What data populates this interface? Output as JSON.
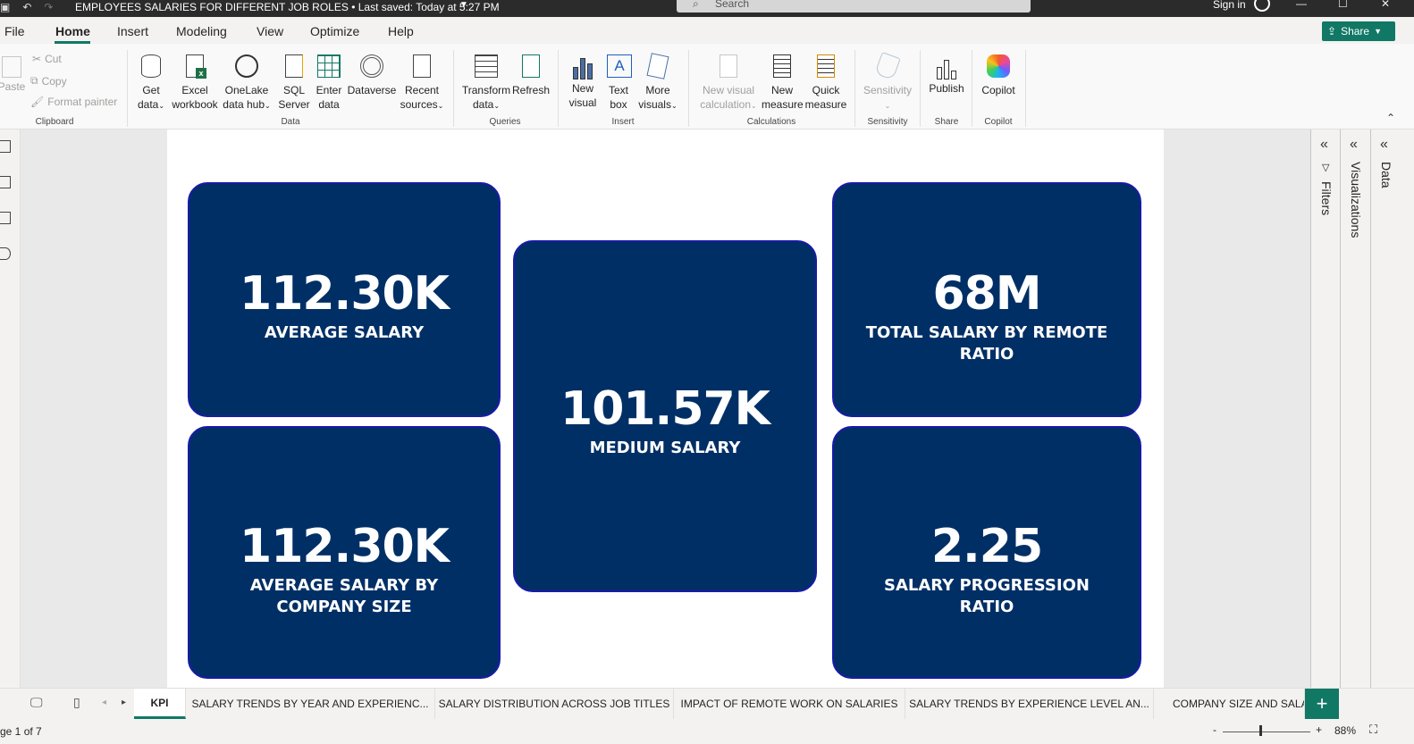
{
  "titlebar": {
    "title": "EMPLOYEES SALARIES FOR DIFFERENT JOB ROLES • Last saved: Today at 5:27 PM",
    "search_placeholder": "Search",
    "sign_in": "Sign in"
  },
  "menu": {
    "items": [
      "File",
      "Home",
      "Insert",
      "Modeling",
      "View",
      "Optimize",
      "Help"
    ],
    "active": "Home",
    "share": "Share"
  },
  "ribbon": {
    "clipboard": {
      "paste": "Paste",
      "cut": "Cut",
      "copy": "Copy",
      "format_painter": "Format painter",
      "label": "Clipboard"
    },
    "data": {
      "get_data": [
        "Get",
        "data"
      ],
      "excel": [
        "Excel",
        "workbook"
      ],
      "onelake": [
        "OneLake",
        "data hub"
      ],
      "sql": [
        "SQL",
        "Server"
      ],
      "enter": [
        "Enter",
        "data"
      ],
      "dataverse": "Dataverse",
      "recent": [
        "Recent",
        "sources"
      ],
      "label": "Data"
    },
    "queries": {
      "transform": [
        "Transform",
        "data"
      ],
      "refresh": "Refresh",
      "label": "Queries"
    },
    "insert": {
      "new_visual": [
        "New",
        "visual"
      ],
      "text_box": [
        "Text",
        "box"
      ],
      "more_visuals": [
        "More",
        "visuals"
      ],
      "label": "Insert"
    },
    "calculations": {
      "new_visual_calc": [
        "New visual",
        "calculation"
      ],
      "new_measure": [
        "New",
        "measure"
      ],
      "quick_measure": [
        "Quick",
        "measure"
      ],
      "label": "Calculations"
    },
    "sensitivity": {
      "btn": "Sensitivity",
      "label": "Sensitivity"
    },
    "share": {
      "publish": "Publish",
      "label": "Share"
    },
    "copilot": {
      "btn": "Copilot",
      "label": "Copilot"
    }
  },
  "kpis": {
    "avg_salary": {
      "value": "112.30K",
      "label": "AVERAGE SALARY"
    },
    "medium_salary": {
      "value": "101.57K",
      "label": "MEDIUM SALARY"
    },
    "total_remote": {
      "value": "68M",
      "label": "TOTAL SALARY BY REMOTE RATIO"
    },
    "avg_company": {
      "value": "112.30K",
      "label": "AVERAGE SALARY BY COMPANY SIZE"
    },
    "progression": {
      "value": "2.25",
      "label": "SALARY PROGRESSION RATIO"
    }
  },
  "panes": {
    "filters": "Filters",
    "visualizations": "Visualizations",
    "data": "Data"
  },
  "tabs": [
    "KPI",
    "SALARY TRENDS BY YEAR AND EXPERIENC...",
    "SALARY DISTRIBUTION ACROSS JOB TITLES",
    "IMPACT OF REMOTE WORK ON SALARIES",
    "SALARY TRENDS BY EXPERIENCE LEVEL AN...",
    "COMPANY SIZE AND SALAR"
  ],
  "status": {
    "page": "ge 1 of 7",
    "zoom": "88%"
  },
  "colors": {
    "card_bg": "#002f66",
    "card_border": "#1a1aa8",
    "accent": "#117865"
  }
}
